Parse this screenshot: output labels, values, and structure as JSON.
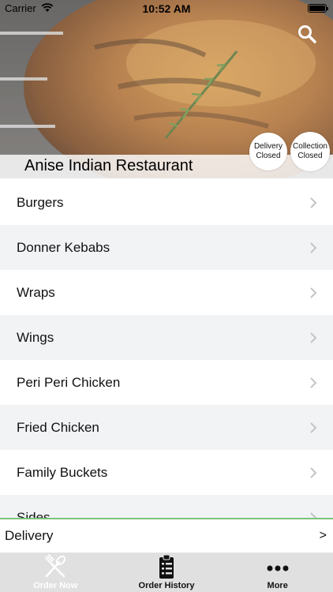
{
  "status_bar": {
    "carrier": "Carrier",
    "time": "10:52 AM"
  },
  "header": {
    "restaurant_name": "Anise Indian Restaurant",
    "delivery_badge": {
      "line1": "Delivery",
      "line2": "Closed"
    },
    "collection_badge": {
      "line1": "Collection",
      "line2": "Closed"
    }
  },
  "categories": [
    {
      "label": "Burgers"
    },
    {
      "label": "Donner Kebabs"
    },
    {
      "label": "Wraps"
    },
    {
      "label": "Wings"
    },
    {
      "label": "Peri Peri Chicken"
    },
    {
      "label": "Fried Chicken"
    },
    {
      "label": "Family Buckets"
    },
    {
      "label": "Sides"
    }
  ],
  "order_mode_bar": {
    "label": "Delivery",
    "arrow": ">"
  },
  "tabs": [
    {
      "label": "Order Now",
      "icon": "fork-knife-icon",
      "active": true
    },
    {
      "label": "Order History",
      "icon": "clipboard-list-icon",
      "active": false
    },
    {
      "label": "More",
      "icon": "more-dots-icon",
      "active": false
    }
  ],
  "colors": {
    "accent_line": "#7cc47a",
    "tab_bar_bg": "#e0e0e0",
    "row_alt_bg": "#f2f3f5"
  }
}
